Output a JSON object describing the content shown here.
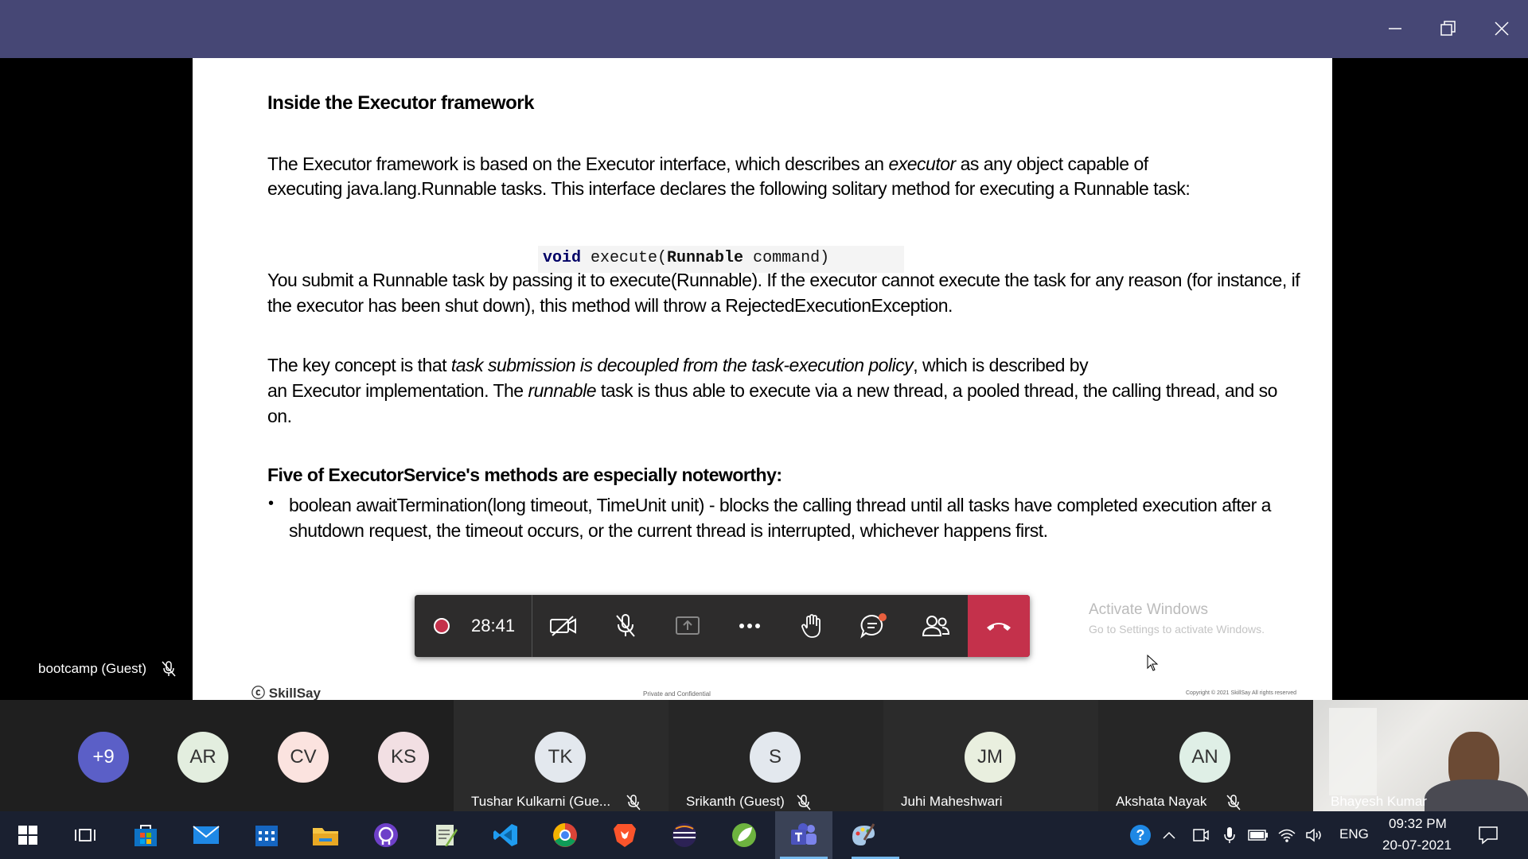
{
  "slide": {
    "heading": "Inside the Executor framework",
    "p1_line1_a": "The Executor framework is based on the Executor interface, which describes an ",
    "p1_line1_em": "executor",
    "p1_line1_b": " as any object capable of",
    "p1_line2": "executing java.lang.Runnable tasks. This interface declares the following solitary method for executing a Runnable task:",
    "code_kw": "void",
    "code_mid": " execute(",
    "code_type": "Runnable",
    "code_end": " command)",
    "p2_line1": "You submit a Runnable task by passing it to execute(Runnable). If the executor cannot execute the task for any reason (for instance, if",
    "p2_line2": "the executor has been shut down), this method will throw a RejectedExecutionException.",
    "p3_line1_a": "The key concept is that ",
    "p3_line1_em": "task submission is decoupled from the task-execution policy",
    "p3_line1_b": ", which is described by",
    "p3_line2_a": "an Executor implementation. The ",
    "p3_line2_em": "runnable",
    "p3_line2_b": " task is thus able to execute via a new thread, a pooled thread, the calling thread, and so",
    "p3_line3": "on.",
    "subheading": "Five of ExecutorService's methods are especially noteworthy:",
    "bullet_line1": "boolean awaitTermination(long timeout, TimeUnit unit) - blocks the calling thread until all tasks have completed execution after a",
    "bullet_line2": "shutdown request, the timeout occurs, or the current thread is interrupted, whichever happens first.",
    "footer_brand": "SkillSay",
    "footer_mid": "Private and Confidential",
    "footer_right": "Copyright © 2021 SkillSay All rights reserved"
  },
  "watermark": {
    "line1": "Activate Windows",
    "line2": "Go to Settings to activate Windows."
  },
  "self_view": {
    "label": "bootcamp (Guest)"
  },
  "call_controls": {
    "timer": "28:41"
  },
  "participants": [
    {
      "initials": "+9",
      "color": "#5b5fc7"
    },
    {
      "initials": "AR",
      "color": "#e3eedf"
    },
    {
      "initials": "CV",
      "color": "#fbe3df"
    },
    {
      "initials": "KS",
      "color": "#f2dfe3"
    },
    {
      "initials": "TK",
      "name": "Tushar Kulkarni (Gue...",
      "color": "#e3e8ee"
    },
    {
      "initials": "S",
      "name": "Srikanth (Guest)",
      "color": "#e3e8ee"
    },
    {
      "initials": "JM",
      "name": "Juhi Maheshwari",
      "color": "#e9efdf"
    },
    {
      "initials": "AN",
      "name": "Akshata Nayak",
      "color": "#dfefe6"
    }
  ],
  "camera": {
    "name": "Bhayesh Kumar"
  },
  "tray": {
    "lang": "ENG",
    "time": "09:32 PM",
    "date": "20-07-2021"
  }
}
